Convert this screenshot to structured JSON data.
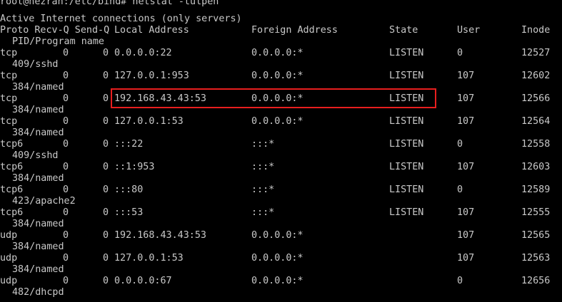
{
  "terminal": {
    "prompt_partial": "root@hezran:/etc/bind# netstat -tulpen",
    "header_line1": "Active Internet connections (only servers)",
    "headers": {
      "proto_recvq_sendq": "Proto Recv-Q Send-Q",
      "local": "Local Address",
      "foreign": "Foreign Address",
      "state": "State",
      "user": "User",
      "inode": "Inode",
      "pid": "PID/Program name"
    },
    "rows": [
      {
        "proto": "tcp",
        "recv": "0",
        "send": "0",
        "local": "0.0.0.0:22",
        "foreign": "0.0.0.0:*",
        "state": "LISTEN",
        "user": "0",
        "inode": "12527",
        "pid": "409/sshd"
      },
      {
        "proto": "tcp",
        "recv": "0",
        "send": "0",
        "local": "127.0.0.1:953",
        "foreign": "0.0.0.0:*",
        "state": "LISTEN",
        "user": "107",
        "inode": "12602",
        "pid": "384/named"
      },
      {
        "proto": "tcp",
        "recv": "0",
        "send": "0",
        "local": "192.168.43.43:53",
        "foreign": "0.0.0.0:*",
        "state": "LISTEN",
        "user": "107",
        "inode": "12566",
        "pid": "384/named"
      },
      {
        "proto": "tcp",
        "recv": "0",
        "send": "0",
        "local": "127.0.0.1:53",
        "foreign": "0.0.0.0:*",
        "state": "LISTEN",
        "user": "107",
        "inode": "12564",
        "pid": "384/named"
      },
      {
        "proto": "tcp6",
        "recv": "0",
        "send": "0",
        "local": ":::22",
        "foreign": ":::*",
        "state": "LISTEN",
        "user": "0",
        "inode": "12558",
        "pid": "409/sshd"
      },
      {
        "proto": "tcp6",
        "recv": "0",
        "send": "0",
        "local": "::1:953",
        "foreign": ":::*",
        "state": "LISTEN",
        "user": "107",
        "inode": "12603",
        "pid": "384/named"
      },
      {
        "proto": "tcp6",
        "recv": "0",
        "send": "0",
        "local": ":::80",
        "foreign": ":::*",
        "state": "LISTEN",
        "user": "0",
        "inode": "12589",
        "pid": "423/apache2"
      },
      {
        "proto": "tcp6",
        "recv": "0",
        "send": "0",
        "local": ":::53",
        "foreign": ":::*",
        "state": "LISTEN",
        "user": "107",
        "inode": "12555",
        "pid": "384/named"
      },
      {
        "proto": "udp",
        "recv": "0",
        "send": "0",
        "local": "192.168.43.43:53",
        "foreign": "0.0.0.0:*",
        "state": "",
        "user": "107",
        "inode": "12565",
        "pid": "384/named"
      },
      {
        "proto": "udp",
        "recv": "0",
        "send": "0",
        "local": "127.0.0.1:53",
        "foreign": "0.0.0.0:*",
        "state": "",
        "user": "107",
        "inode": "12563",
        "pid": "384/named"
      },
      {
        "proto": "udp",
        "recv": "0",
        "send": "0",
        "local": "0.0.0.0:67",
        "foreign": "0.0.0.0:*",
        "state": "",
        "user": "0",
        "inode": "12656",
        "pid": "482/dhcpd"
      }
    ],
    "highlight_color": "#e81e1e",
    "text_color": "#c9c9c9",
    "background": "#000000"
  }
}
